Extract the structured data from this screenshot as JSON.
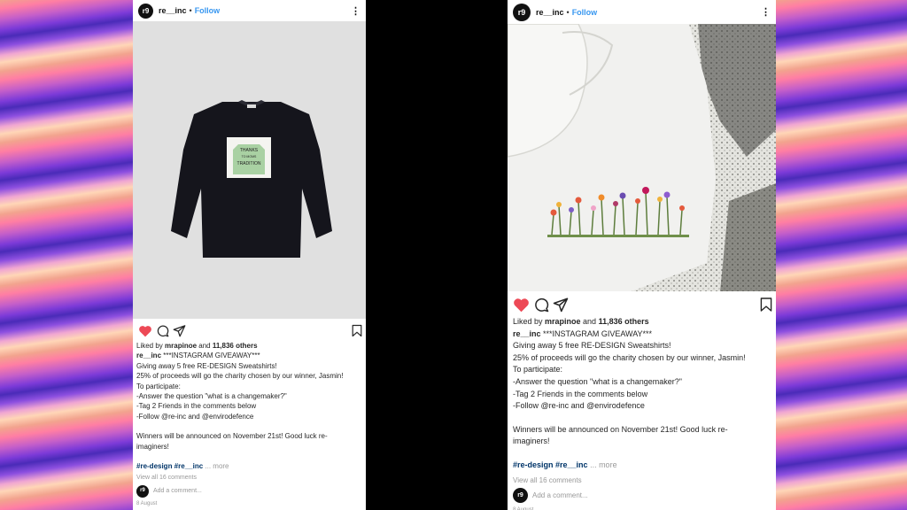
{
  "account": {
    "username": "re__inc",
    "avatar_text": "r9",
    "follow_label": "Follow",
    "dot": "•",
    "more_icon": "⋮"
  },
  "caption": {
    "likes_prefix": "Liked by ",
    "likes_user": "mrapinoe",
    "likes_mid": " and ",
    "likes_count": "11,836 others",
    "author": "re__inc",
    "lines": [
      " ***INSTAGRAM GIVEAWAY***",
      "Giving away 5 free RE-DESIGN Sweatshirts!",
      "25% of proceeds will go the charity chosen by our winner, Jasmin!",
      "To participate:",
      "-Answer the question \"what is a changemaker?\"",
      "-Tag 2 Friends in the comments below",
      "-Follow @re-inc and @envirodefence",
      "Winners will be announced on November 21st! Good luck re-",
      "imaginers!"
    ],
    "tags": "#re-design #re__inc",
    "more_label": "... more",
    "view_comments": "View all 16 comments",
    "add_comment_placeholder": "Add a comment...",
    "date": "8 August"
  },
  "sweatshirt_print": {
    "line1": "THANKS",
    "line2": "TO MOMS",
    "line3": "TRADITION"
  },
  "colors": {
    "like_red": "#ed4956",
    "follow_blue": "#3897f0",
    "tag_blue": "#003569"
  }
}
